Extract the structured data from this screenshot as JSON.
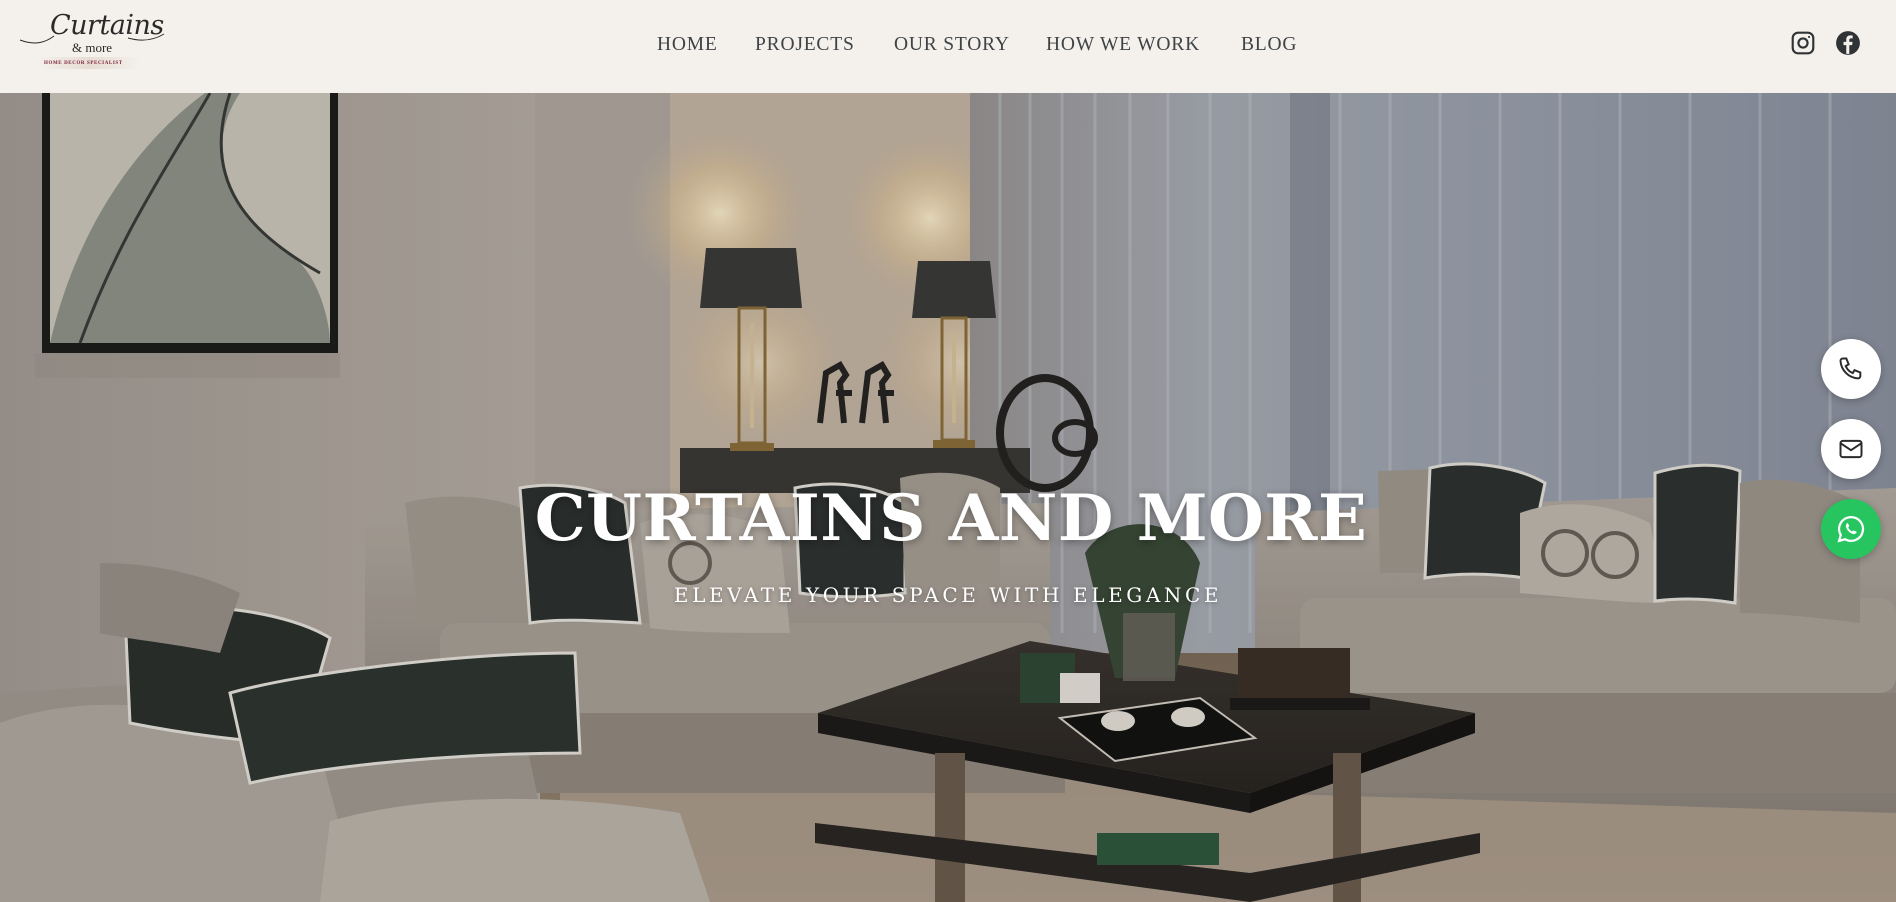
{
  "header": {
    "logo": {
      "script": "Curtains",
      "amp": "& more",
      "tagline": "HOME DECOR SPECIALIST"
    },
    "nav": [
      {
        "label": "HOME"
      },
      {
        "label": "PROJECTS"
      },
      {
        "label": "OUR STORY"
      },
      {
        "label": "HOW WE WORK"
      },
      {
        "label": "BLOG"
      }
    ],
    "social": [
      {
        "icon": "instagram-icon"
      },
      {
        "icon": "facebook-icon"
      }
    ]
  },
  "hero": {
    "title": "CURTAINS AND MORE",
    "subtitle": "ELEVATE YOUR SPACE WITH ELEGANCE"
  },
  "floating_buttons": [
    {
      "icon": "phone-icon"
    },
    {
      "icon": "mail-icon"
    },
    {
      "icon": "whatsapp-icon"
    }
  ],
  "colors": {
    "header_bg": "#f4f1ec",
    "nav_text": "#3f4346",
    "hero_text": "#ffffff",
    "whatsapp": "#27c560"
  }
}
